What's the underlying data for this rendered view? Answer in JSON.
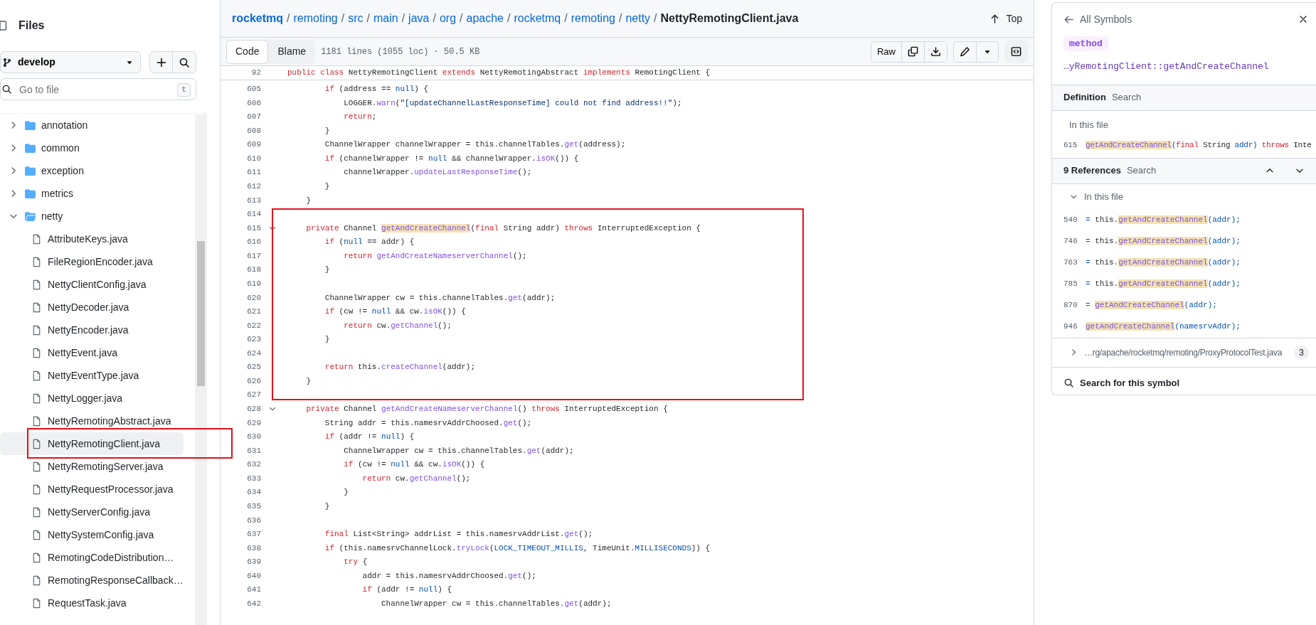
{
  "sidebar": {
    "title": "Files",
    "branch": "develop",
    "search": {
      "placeholder": "Go to file",
      "shortcut": "t"
    },
    "tree": [
      {
        "kind": "folder",
        "label": "annotation",
        "expanded": false
      },
      {
        "kind": "folder",
        "label": "common",
        "expanded": false
      },
      {
        "kind": "folder",
        "label": "exception",
        "expanded": false
      },
      {
        "kind": "folder",
        "label": "metrics",
        "expanded": false
      },
      {
        "kind": "folder",
        "label": "netty",
        "expanded": true,
        "children": [
          {
            "kind": "file",
            "label": "AttributeKeys.java",
            "selected": false
          },
          {
            "kind": "file",
            "label": "FileRegionEncoder.java",
            "selected": false
          },
          {
            "kind": "file",
            "label": "NettyClientConfig.java",
            "selected": false
          },
          {
            "kind": "file",
            "label": "NettyDecoder.java",
            "selected": false
          },
          {
            "kind": "file",
            "label": "NettyEncoder.java",
            "selected": false
          },
          {
            "kind": "file",
            "label": "NettyEvent.java",
            "selected": false
          },
          {
            "kind": "file",
            "label": "NettyEventType.java",
            "selected": false
          },
          {
            "kind": "file",
            "label": "NettyLogger.java",
            "selected": false
          },
          {
            "kind": "file",
            "label": "NettyRemotingAbstract.java",
            "selected": false
          },
          {
            "kind": "file",
            "label": "NettyRemotingClient.java",
            "selected": true
          },
          {
            "kind": "file",
            "label": "NettyRemotingServer.java",
            "selected": false
          },
          {
            "kind": "file",
            "label": "NettyRequestProcessor.java",
            "selected": false
          },
          {
            "kind": "file",
            "label": "NettyServerConfig.java",
            "selected": false
          },
          {
            "kind": "file",
            "label": "NettySystemConfig.java",
            "selected": false
          },
          {
            "kind": "file",
            "label": "RemotingCodeDistribution…",
            "selected": false
          },
          {
            "kind": "file",
            "label": "RemotingResponseCallback…",
            "selected": false
          },
          {
            "kind": "file",
            "label": "RequestTask.java",
            "selected": false
          }
        ]
      }
    ]
  },
  "breadcrumb": {
    "items": [
      {
        "kind": "root",
        "text": "rocketmq"
      },
      {
        "kind": "separator",
        "text": "/"
      },
      {
        "kind": "link",
        "text": "remoting"
      },
      {
        "kind": "separator",
        "text": "/"
      },
      {
        "kind": "link",
        "text": "src"
      },
      {
        "kind": "separator",
        "text": "/"
      },
      {
        "kind": "link",
        "text": "main"
      },
      {
        "kind": "separator",
        "text": "/"
      },
      {
        "kind": "link",
        "text": "java"
      },
      {
        "kind": "separator",
        "text": "/"
      },
      {
        "kind": "link",
        "text": "org"
      },
      {
        "kind": "separator",
        "text": "/"
      },
      {
        "kind": "link",
        "text": "apache"
      },
      {
        "kind": "separator",
        "text": "/"
      },
      {
        "kind": "link",
        "text": "rocketmq"
      },
      {
        "kind": "separator",
        "text": "/"
      },
      {
        "kind": "link",
        "text": "remoting"
      },
      {
        "kind": "separator",
        "text": "/"
      },
      {
        "kind": "link",
        "text": "netty"
      },
      {
        "kind": "separator",
        "text": "/"
      },
      {
        "kind": "file",
        "text": "NettyRemotingClient.java"
      }
    ],
    "top": "Top"
  },
  "toolbar": {
    "tabs": [
      {
        "label": "Code",
        "selected": true
      },
      {
        "label": "Blame",
        "selected": false
      }
    ],
    "info": "1181 lines (1055 loc) · 50.5 KB",
    "raw": "Raw"
  },
  "code": {
    "sticky": {
      "number": "92",
      "tokens": [
        {
          "kind": "k",
          "text": "public class"
        },
        {
          "kind": "p",
          "text": " NettyRemotingClient "
        },
        {
          "kind": "k",
          "text": "extends"
        },
        {
          "kind": "p",
          "text": " NettyRemotingAbstract "
        },
        {
          "kind": "k",
          "text": "implements"
        },
        {
          "kind": "p",
          "text": " RemotingClient {"
        }
      ]
    },
    "lines": [
      {
        "number": "605",
        "foldable": false,
        "tokens": [
          {
            "kind": "k",
            "text": "        if"
          },
          {
            "kind": "p",
            "text": " (address == "
          },
          {
            "kind": "c",
            "text": "null"
          },
          {
            "kind": "p",
            "text": ") {"
          }
        ]
      },
      {
        "number": "606",
        "foldable": false,
        "tokens": [
          {
            "kind": "p",
            "text": "            LOGGER."
          },
          {
            "kind": "f",
            "text": "warn"
          },
          {
            "kind": "p",
            "text": "("
          },
          {
            "kind": "s",
            "text": "\"[updateChannelLastResponseTime] could not find address!!\""
          },
          {
            "kind": "p",
            "text": ");"
          }
        ]
      },
      {
        "number": "607",
        "foldable": false,
        "tokens": [
          {
            "kind": "k",
            "text": "            return"
          },
          {
            "kind": "p",
            "text": ";"
          }
        ]
      },
      {
        "number": "608",
        "foldable": false,
        "tokens": [
          {
            "kind": "p",
            "text": "        }"
          }
        ]
      },
      {
        "number": "609",
        "foldable": false,
        "tokens": [
          {
            "kind": "p",
            "text": "        ChannelWrapper channelWrapper = this.channelTables."
          },
          {
            "kind": "f",
            "text": "get"
          },
          {
            "kind": "p",
            "text": "(address);"
          }
        ]
      },
      {
        "number": "610",
        "foldable": false,
        "tokens": [
          {
            "kind": "k",
            "text": "        if"
          },
          {
            "kind": "p",
            "text": " (channelWrapper != "
          },
          {
            "kind": "c",
            "text": "null"
          },
          {
            "kind": "p",
            "text": " && channelWrapper."
          },
          {
            "kind": "f",
            "text": "isOK"
          },
          {
            "kind": "p",
            "text": "()) {"
          }
        ]
      },
      {
        "number": "611",
        "foldable": false,
        "tokens": [
          {
            "kind": "p",
            "text": "            channelWrapper."
          },
          {
            "kind": "f",
            "text": "updateLastResponseTime"
          },
          {
            "kind": "p",
            "text": "();"
          }
        ]
      },
      {
        "number": "612",
        "foldable": false,
        "tokens": [
          {
            "kind": "p",
            "text": "        }"
          }
        ]
      },
      {
        "number": "613",
        "foldable": false,
        "tokens": [
          {
            "kind": "p",
            "text": "    }"
          }
        ]
      },
      {
        "number": "614",
        "foldable": false
      },
      {
        "number": "615",
        "foldable": true,
        "tokens": [
          {
            "kind": "k",
            "text": "    private"
          },
          {
            "kind": "p",
            "text": " Channel "
          },
          {
            "kind": "h",
            "text": "getAndCreateChannel"
          },
          {
            "kind": "p",
            "text": "("
          },
          {
            "kind": "k",
            "text": "final"
          },
          {
            "kind": "p",
            "text": " String addr) "
          },
          {
            "kind": "k",
            "text": "throws"
          },
          {
            "kind": "p",
            "text": " InterruptedException {"
          }
        ]
      },
      {
        "number": "616",
        "foldable": false,
        "tokens": [
          {
            "kind": "k",
            "text": "        if"
          },
          {
            "kind": "p",
            "text": " ("
          },
          {
            "kind": "c",
            "text": "null"
          },
          {
            "kind": "p",
            "text": " == addr) {"
          }
        ]
      },
      {
        "number": "617",
        "foldable": false,
        "tokens": [
          {
            "kind": "k",
            "text": "            return"
          },
          {
            "kind": "f",
            "text": " getAndCreateNameserverChannel"
          },
          {
            "kind": "p",
            "text": "();"
          }
        ]
      },
      {
        "number": "618",
        "foldable": false,
        "tokens": [
          {
            "kind": "p",
            "text": "        }"
          }
        ]
      },
      {
        "number": "619",
        "foldable": false
      },
      {
        "number": "620",
        "foldable": false,
        "tokens": [
          {
            "kind": "p",
            "text": "        ChannelWrapper cw = this.channelTables."
          },
          {
            "kind": "f",
            "text": "get"
          },
          {
            "kind": "p",
            "text": "(addr);"
          }
        ]
      },
      {
        "number": "621",
        "foldable": false,
        "tokens": [
          {
            "kind": "k",
            "text": "        if"
          },
          {
            "kind": "p",
            "text": " (cw != "
          },
          {
            "kind": "c",
            "text": "null"
          },
          {
            "kind": "p",
            "text": " && cw."
          },
          {
            "kind": "f",
            "text": "isOK"
          },
          {
            "kind": "p",
            "text": "()) {"
          }
        ]
      },
      {
        "number": "622",
        "foldable": false,
        "tokens": [
          {
            "kind": "k",
            "text": "            return"
          },
          {
            "kind": "p",
            "text": " cw."
          },
          {
            "kind": "f",
            "text": "getChannel"
          },
          {
            "kind": "p",
            "text": "();"
          }
        ]
      },
      {
        "number": "623",
        "foldable": false,
        "tokens": [
          {
            "kind": "p",
            "text": "        }"
          }
        ]
      },
      {
        "number": "624",
        "foldable": false
      },
      {
        "number": "625",
        "foldable": false,
        "tokens": [
          {
            "kind": "k",
            "text": "        return"
          },
          {
            "kind": "p",
            "text": " this."
          },
          {
            "kind": "f",
            "text": "createChannel"
          },
          {
            "kind": "p",
            "text": "(addr);"
          }
        ]
      },
      {
        "number": "626",
        "foldable": false,
        "tokens": [
          {
            "kind": "p",
            "text": "    }"
          }
        ]
      },
      {
        "number": "627",
        "foldable": false
      },
      {
        "number": "628",
        "foldable": true,
        "tokens": [
          {
            "kind": "k",
            "text": "    private"
          },
          {
            "kind": "p",
            "text": " Channel "
          },
          {
            "kind": "f",
            "text": "getAndCreateNameserverChannel"
          },
          {
            "kind": "p",
            "text": "() "
          },
          {
            "kind": "k",
            "text": "throws"
          },
          {
            "kind": "p",
            "text": " InterruptedException {"
          }
        ]
      },
      {
        "number": "629",
        "foldable": false,
        "tokens": [
          {
            "kind": "p",
            "text": "        String addr = this.namesrvAddrChoosed."
          },
          {
            "kind": "f",
            "text": "get"
          },
          {
            "kind": "p",
            "text": "();"
          }
        ]
      },
      {
        "number": "630",
        "foldable": false,
        "tokens": [
          {
            "kind": "k",
            "text": "        if"
          },
          {
            "kind": "p",
            "text": " (addr != "
          },
          {
            "kind": "c",
            "text": "null"
          },
          {
            "kind": "p",
            "text": ") {"
          }
        ]
      },
      {
        "number": "631",
        "foldable": false,
        "tokens": [
          {
            "kind": "p",
            "text": "            ChannelWrapper cw = this.channelTables."
          },
          {
            "kind": "f",
            "text": "get"
          },
          {
            "kind": "p",
            "text": "(addr);"
          }
        ]
      },
      {
        "number": "632",
        "foldable": false,
        "tokens": [
          {
            "kind": "k",
            "text": "            if"
          },
          {
            "kind": "p",
            "text": " (cw != "
          },
          {
            "kind": "c",
            "text": "null"
          },
          {
            "kind": "p",
            "text": " && cw."
          },
          {
            "kind": "f",
            "text": "isOK"
          },
          {
            "kind": "p",
            "text": "()) {"
          }
        ]
      },
      {
        "number": "633",
        "foldable": false,
        "tokens": [
          {
            "kind": "k",
            "text": "                return"
          },
          {
            "kind": "p",
            "text": " cw."
          },
          {
            "kind": "f",
            "text": "getChannel"
          },
          {
            "kind": "p",
            "text": "();"
          }
        ]
      },
      {
        "number": "634",
        "foldable": false,
        "tokens": [
          {
            "kind": "p",
            "text": "            }"
          }
        ]
      },
      {
        "number": "635",
        "foldable": false,
        "tokens": [
          {
            "kind": "p",
            "text": "        }"
          }
        ]
      },
      {
        "number": "636",
        "foldable": false
      },
      {
        "number": "637",
        "foldable": false,
        "tokens": [
          {
            "kind": "k",
            "text": "        final"
          },
          {
            "kind": "p",
            "text": " List<String> addrList = this.namesrvAddrList."
          },
          {
            "kind": "f",
            "text": "get"
          },
          {
            "kind": "p",
            "text": "();"
          }
        ]
      },
      {
        "number": "638",
        "foldable": false,
        "tokens": [
          {
            "kind": "k",
            "text": "        if"
          },
          {
            "kind": "p",
            "text": " (this.namesrvChannelLock."
          },
          {
            "kind": "f",
            "text": "tryLock"
          },
          {
            "kind": "p",
            "text": "("
          },
          {
            "kind": "c",
            "text": "LOCK_TIMEOUT_MILLIS"
          },
          {
            "kind": "p",
            "text": ", TimeUnit."
          },
          {
            "kind": "c",
            "text": "MILLISECONDS"
          },
          {
            "kind": "p",
            "text": ")) {"
          }
        ]
      },
      {
        "number": "639",
        "foldable": false,
        "tokens": [
          {
            "kind": "k",
            "text": "            try"
          },
          {
            "kind": "p",
            "text": " {"
          }
        ]
      },
      {
        "number": "640",
        "foldable": false,
        "tokens": [
          {
            "kind": "p",
            "text": "                addr = this.namesrvAddrChoosed."
          },
          {
            "kind": "f",
            "text": "get"
          },
          {
            "kind": "p",
            "text": "();"
          }
        ]
      },
      {
        "number": "641",
        "foldable": false,
        "tokens": [
          {
            "kind": "k",
            "text": "                if"
          },
          {
            "kind": "p",
            "text": " (addr != "
          },
          {
            "kind": "c",
            "text": "null"
          },
          {
            "kind": "p",
            "text": ") {"
          }
        ]
      },
      {
        "number": "642",
        "foldable": false,
        "tokens": [
          {
            "kind": "p",
            "text": "                    ChannelWrapper cw = this.channelTables."
          },
          {
            "kind": "f",
            "text": "get"
          },
          {
            "kind": "p",
            "text": "(addr);"
          }
        ]
      }
    ]
  },
  "symbols": {
    "back": "All Symbols",
    "kind": "method",
    "name": "…yRemotingClient::getAndCreateChannel",
    "definition": {
      "title": "Definition",
      "search": "Search",
      "scope": "In this file",
      "items": [
        {
          "number": "615",
          "tokens": [
            {
              "kind": "h",
              "text": "getAndCreateChannel"
            },
            {
              "kind": "c",
              "text": "("
            },
            {
              "kind": "k",
              "text": "final"
            },
            {
              "kind": "p",
              "text": " String "
            },
            {
              "kind": "c",
              "text": "addr)"
            },
            {
              "kind": "k",
              "text": " throws"
            },
            {
              "kind": "p",
              "text": " Inte"
            }
          ]
        }
      ]
    },
    "references": {
      "title": "9 References",
      "search": "Search",
      "groups": [
        {
          "label": "In this file",
          "expanded": true,
          "items": [
            {
              "number": "540",
              "tokens": [
                {
                  "kind": "c",
                  "text": "= "
                },
                {
                  "kind": "p",
                  "text": "this."
                },
                {
                  "kind": "h",
                  "text": "getAndCreateChannel"
                },
                {
                  "kind": "c",
                  "text": "(addr);"
                }
              ]
            },
            {
              "number": "746",
              "tokens": [
                {
                  "kind": "c",
                  "text": "= "
                },
                {
                  "kind": "p",
                  "text": "this."
                },
                {
                  "kind": "h",
                  "text": "getAndCreateChannel"
                },
                {
                  "kind": "c",
                  "text": "(addr);"
                }
              ]
            },
            {
              "number": "763",
              "tokens": [
                {
                  "kind": "c",
                  "text": "= "
                },
                {
                  "kind": "p",
                  "text": "this."
                },
                {
                  "kind": "h",
                  "text": "getAndCreateChannel"
                },
                {
                  "kind": "c",
                  "text": "(addr);"
                }
              ]
            },
            {
              "number": "785",
              "tokens": [
                {
                  "kind": "c",
                  "text": "= "
                },
                {
                  "kind": "p",
                  "text": "this."
                },
                {
                  "kind": "h",
                  "text": "getAndCreateChannel"
                },
                {
                  "kind": "c",
                  "text": "(addr);"
                }
              ]
            },
            {
              "number": "870",
              "tokens": [
                {
                  "kind": "c",
                  "text": "= "
                },
                {
                  "kind": "h",
                  "text": "getAndCreateChannel"
                },
                {
                  "kind": "c",
                  "text": "(addr);"
                }
              ]
            },
            {
              "number": "946",
              "tokens": [
                {
                  "kind": "h",
                  "text": "getAndCreateChannel"
                },
                {
                  "kind": "c",
                  "text": "(namesrvAddr);"
                }
              ]
            }
          ]
        },
        {
          "label": "…rg/apache/rocketmq/remoting/ProxyProtocolTest.java",
          "expanded": false,
          "count": "3"
        }
      ]
    },
    "search_symbol": "Search for this symbol"
  }
}
